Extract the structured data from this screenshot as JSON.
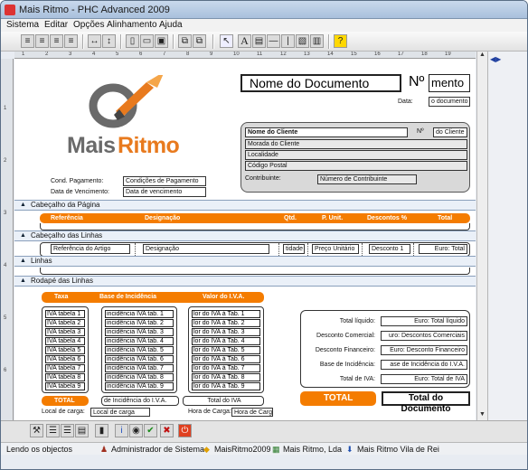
{
  "window": {
    "title": "Mais Ritmo - PHC Advanced 2009"
  },
  "menu": [
    "Sistema",
    "Editar",
    "Opções",
    "Alinhamento",
    "Ajuda"
  ],
  "toolbar": {
    "tool_a": "A",
    "tool_check": "?"
  },
  "ruler": [
    "1",
    "2",
    "3",
    "4",
    "5",
    "6",
    "7",
    "8",
    "9",
    "10",
    "11",
    "12",
    "13",
    "14",
    "15",
    "16",
    "17",
    "18",
    "19"
  ],
  "logo": {
    "text_mais": "Mais",
    "text_ritmo": "Ritmo",
    "brand_color": "#e87a1e",
    "gray": "#5e5e5e"
  },
  "header": {
    "doc_name": "Nome do Documento",
    "num_label": "Nº",
    "num_value": "mento",
    "date_label": "Data:",
    "date_value": "o documento"
  },
  "client": {
    "name": "Nome do Cliente",
    "num_label": "Nº",
    "num_value": "do Cliente",
    "address": "Morada do Cliente",
    "locality": "Localidade",
    "postal": "Código Postal",
    "contrib_label": "Contribuinte:",
    "contrib_value": "Número de Contribuinte"
  },
  "payment": {
    "cond_label": "Cond. Pagamento:",
    "cond_value": "Condições de Pagamento",
    "due_label": "Data de Vencimento:",
    "due_value": "Data de vencimento"
  },
  "bands": {
    "page_header": "Cabeçalho da Página",
    "lines_header": "Cabeçalho das Linhas",
    "lines": "Linhas",
    "footer": "Rodapé das Linhas"
  },
  "columns": {
    "ref": "Referência",
    "desig": "Designação",
    "qty": "Qtd.",
    "unit": "P. Unit.",
    "disc": "Descontos %",
    "total": "Total"
  },
  "line_fields": {
    "ref": "Referência do Artigo",
    "desig": "Designação",
    "qty": "tidade",
    "unit": "Preço Unitário",
    "disc": "Desconto 1",
    "total": "Euro: Total"
  },
  "vat_headers": {
    "rate": "Taxa",
    "base": "Base de Incidência",
    "value": "Valor do I.V.A."
  },
  "vat_rates": [
    "IVA tabela 1",
    "IVA tabela 2",
    "IVA tabela 3",
    "IVA tabela 4",
    "IVA tabela 5",
    "IVA tabela 6",
    "IVA tabela 7",
    "IVA tabela 8",
    "IVA tabela 9"
  ],
  "vat_bases": [
    "incidência IVA tab. 1",
    "incidência IVA tab. 2",
    "incidência IVA tab. 3",
    "incidência IVA tab. 4",
    "incidência IVA tab. 5",
    "incidência IVA tab. 6",
    "incidência IVA tab. 7",
    "incidência IVA tab. 8",
    "incidência IVA tab. 9"
  ],
  "vat_values": [
    "lor do IVA à Tab. 1",
    "lor do IVA à Tab. 2",
    "lor do IVA à Tab. 3",
    "lor do IVA à Tab. 4",
    "lor do IVA à Tab. 5",
    "lor do IVA à Tab. 6",
    "lor do IVA à Tab. 7",
    "lor do IVA à Tab. 8",
    "lor do IVA à Tab. 9"
  ],
  "vat_totals": {
    "label": "TOTAL",
    "base": "de Incidência do I.V.A.",
    "value": "Total do IVA"
  },
  "summary": {
    "net_label": "Total líquido:",
    "net_value": "Euro: Total líquido",
    "comm_label": "Desconto Comercial:",
    "comm_value": "uro: Descontos Comerciais",
    "fin_label": "Desconto Financeiro:",
    "fin_value": "Euro: Desconto Financeiro",
    "base_label": "Base de Incidência:",
    "base_value": "ase de Incidência do I.V.A.",
    "vat_label": "Total de IVA:",
    "vat_value": "Euro: Total de IVA"
  },
  "grand_total": {
    "label": "TOTAL",
    "value": "Total do Documento"
  },
  "load": {
    "place_label": "Local de carga:",
    "place_value": "Local de carga",
    "time_label": "Hora de Carga:",
    "time_value": "Hora de Carga"
  },
  "statusbar": {
    "msg": "Lendo os objectos",
    "user": "Administrador de Sistema",
    "db": "MaisRitmo2009",
    "company": "Mais Ritmo, Lda",
    "site": "Mais Ritmo Vila de Rei"
  },
  "colors": {
    "orange": "#f47c00",
    "band": "#eaf0f8",
    "client_bg": "#d9d9d9"
  }
}
